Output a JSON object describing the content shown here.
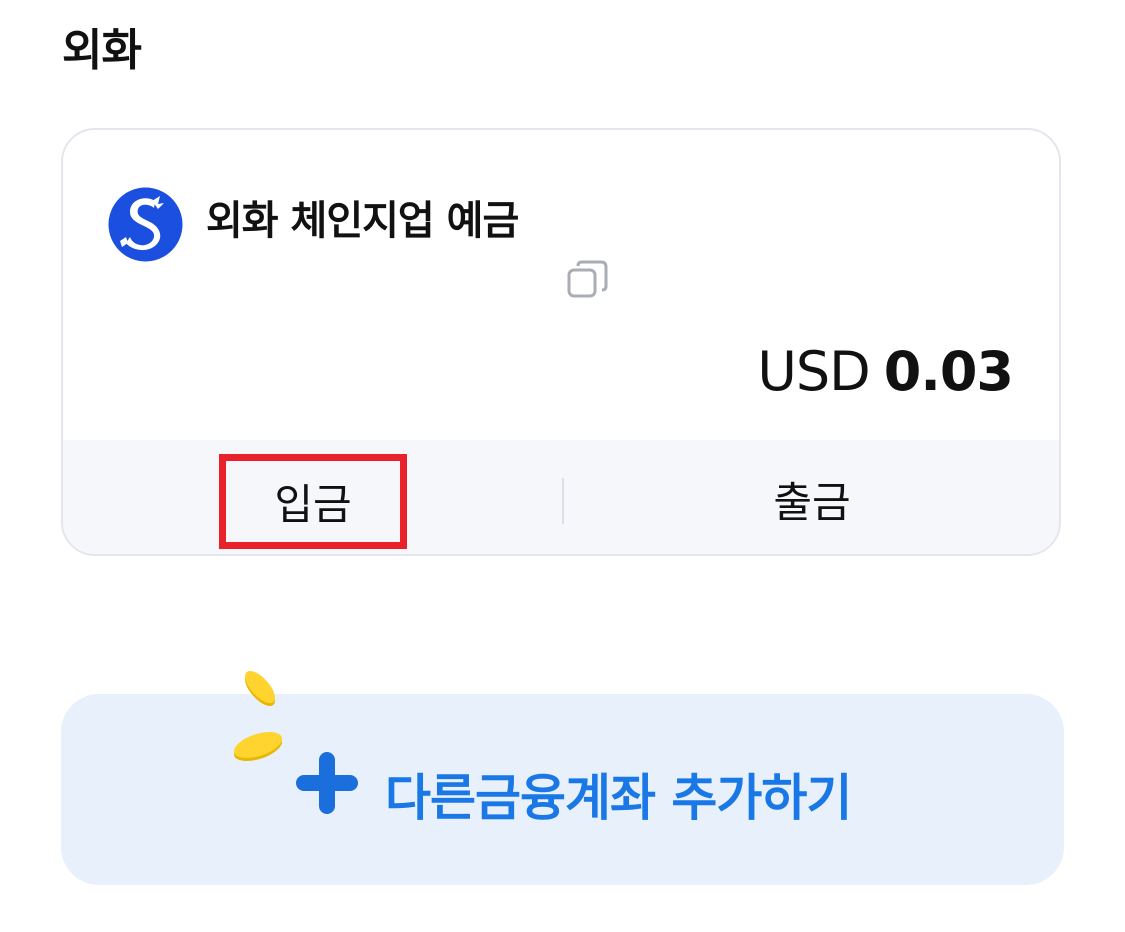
{
  "section": {
    "title": "외화"
  },
  "account": {
    "bank_logo_icon": "shinhan-bank-logo-icon",
    "name": "외화 체인지업 예금",
    "copy_icon": "copy-icon",
    "balance_currency": "USD",
    "balance_amount": "0.03",
    "actions": {
      "deposit_label": "입금",
      "withdraw_label": "출금"
    }
  },
  "add_account": {
    "label": "다른금융계좌 추가하기",
    "plus_icon": "plus-icon",
    "coins_icon": "coins-icon"
  },
  "colors": {
    "brand_blue": "#1a78e6",
    "logo_blue": "#1b4fe0",
    "highlight_red": "#e8212a",
    "card_border": "#e3e6ec",
    "add_bg": "#e7f0fb"
  }
}
